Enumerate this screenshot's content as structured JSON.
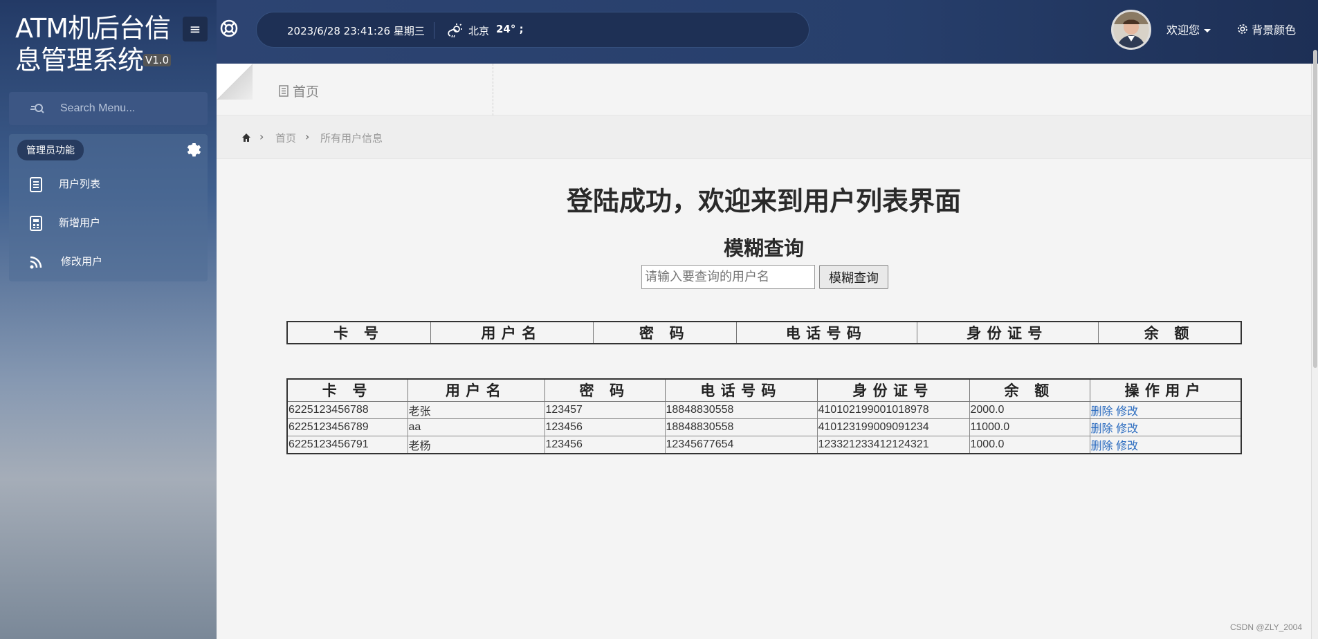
{
  "sidebar": {
    "logo_title": "ATM机后台信息管理系统",
    "version": "V1.0",
    "search_placeholder": "Search Menu...",
    "section_label": "管理员功能",
    "items": [
      {
        "label": "用户列表",
        "icon": "document-icon"
      },
      {
        "label": "新增用户",
        "icon": "calculator-icon"
      },
      {
        "label": "修改用户",
        "icon": "rss-icon"
      }
    ]
  },
  "header": {
    "datetime": "2023/6/28 23:41:26 星期三",
    "city": "北京",
    "temperature": "24° ;",
    "welcome": "欢迎您",
    "bg_color_label": "背景颜色"
  },
  "tabs": {
    "home": "首页"
  },
  "breadcrumb": {
    "home": "首页",
    "current": "所有用户信息"
  },
  "main": {
    "heading": "登陆成功，欢迎来到用户列表界面",
    "search_title": "模糊查询",
    "search_placeholder": "请输入要查询的用户名",
    "search_button": "模糊查询"
  },
  "table1": {
    "headers": [
      "卡  号",
      "用户名",
      "密  码",
      "电话号码",
      "身份证号",
      "余  额"
    ]
  },
  "table2": {
    "headers": [
      "卡  号",
      "用户名",
      "密  码",
      "电话号码",
      "身份证号",
      "余  额",
      "操作用户"
    ],
    "rows": [
      [
        "6225123456788",
        "老张",
        "123457",
        "18848830558",
        "410102199001018978",
        "2000.0"
      ],
      [
        "6225123456789",
        "aa",
        "123456",
        "18848830558",
        "410123199009091234",
        "11000.0"
      ],
      [
        "6225123456791",
        "老杨",
        "123456",
        "12345677654",
        "123321233412124321",
        "1000.0"
      ]
    ],
    "delete_label": "删除",
    "edit_label": "修改"
  },
  "watermark": "CSDN @ZLY_2004"
}
